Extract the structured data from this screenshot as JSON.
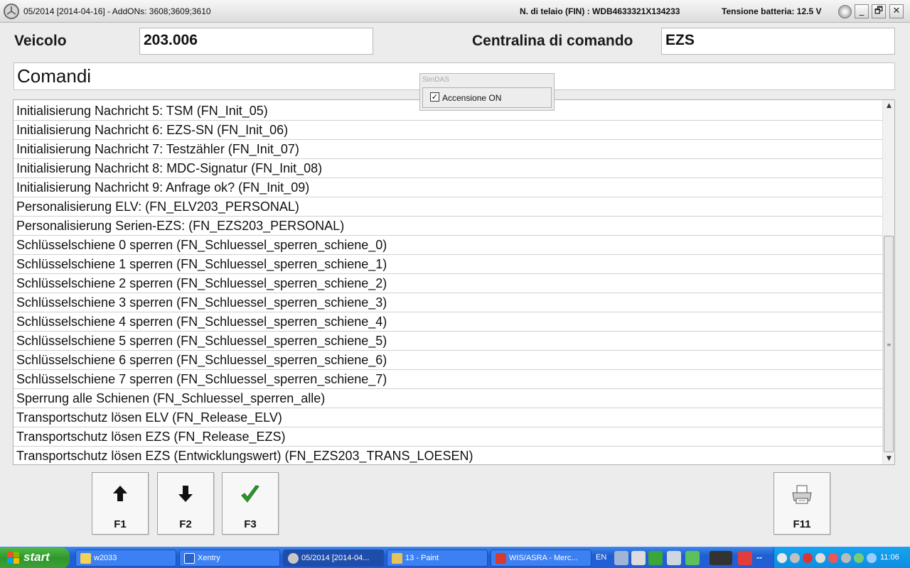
{
  "window": {
    "title": "05/2014 [2014-04-16] - AddONs: 3608;3609;3610",
    "fin": "N. di telaio (FIN) : WDB4633321X134233",
    "battery": "Tensione batteria: 12.5 V",
    "controls": {
      "minimize": "_",
      "maximize": "🗗",
      "close": "✕"
    }
  },
  "header": {
    "vehicle_label": "Veicolo",
    "vehicle_value": "203.006",
    "ecu_label": "Centralina di comando",
    "ecu_value": "EZS"
  },
  "section_title": "Comandi",
  "simdas": {
    "caption": "SimDAS",
    "checkbox_label": "Accensione ON",
    "checked": true,
    "check_mark": "✓"
  },
  "commands": [
    "Initialisierung Nachricht 5: TSM (FN_Init_05)",
    "Initialisierung Nachricht 6: EZS-SN (FN_Init_06)",
    "Initialisierung Nachricht 7: Testzähler (FN_Init_07)",
    "Initialisierung Nachricht 8: MDC-Signatur (FN_Init_08)",
    "Initialisierung Nachricht 9: Anfrage ok? (FN_Init_09)",
    "Personalisierung ELV: (FN_ELV203_PERSONAL)",
    "Personalisierung Serien-EZS: (FN_EZS203_PERSONAL)",
    "Schlüsselschiene 0 sperren (FN_Schluessel_sperren_schiene_0)",
    "Schlüsselschiene 1 sperren (FN_Schluessel_sperren_schiene_1)",
    "Schlüsselschiene 2 sperren (FN_Schluessel_sperren_schiene_2)",
    "Schlüsselschiene 3 sperren (FN_Schluessel_sperren_schiene_3)",
    "Schlüsselschiene 4 sperren (FN_Schluessel_sperren_schiene_4)",
    "Schlüsselschiene 5 sperren (FN_Schluessel_sperren_schiene_5)",
    "Schlüsselschiene 6 sperren (FN_Schluessel_sperren_schiene_6)",
    "Schlüsselschiene 7 sperren (FN_Schluessel_sperren_schiene_7)",
    "Sperrung alle Schienen (FN_Schluessel_sperren_alle)",
    "Transportschutz lösen ELV (FN_Release_ELV)",
    "Transportschutz lösen EZS (FN_Release_EZS)",
    "Transportschutz lösen EZS (Entwicklungswert) (FN_EZS203_TRANS_LOESEN)"
  ],
  "scrollbar": {
    "up_icon": "▲",
    "down_icon": "▼",
    "grip": "≡"
  },
  "function_keys": [
    {
      "label": "F1",
      "icon": "arrow-up-icon"
    },
    {
      "label": "F2",
      "icon": "arrow-down-icon"
    },
    {
      "label": "F3",
      "icon": "checkmark-icon"
    },
    {
      "label": "F11",
      "icon": "printer-icon"
    }
  ],
  "taskbar": {
    "start": "start",
    "tasks": [
      {
        "label": "w2033",
        "icon": "folder-icon",
        "color": "#f3d25a"
      },
      {
        "label": "Xentry",
        "icon": "xentry-icon",
        "color": "#2b63c9"
      },
      {
        "label": "05/2014 [2014-04...",
        "icon": "mercedes-star-icon",
        "color": "#c8c8c8"
      },
      {
        "label": "13 - Paint",
        "icon": "paint-icon",
        "color": "#e7c25a"
      },
      {
        "label": "WIS/ASRA - Merc...",
        "icon": "wis-icon",
        "color": "#d83a2e"
      }
    ],
    "language": "EN",
    "quick_ellipsis": "--",
    "clock": "11:06"
  },
  "colors": {
    "accent_green": "#2c9a2a",
    "taskbar_blue": "#245dd8",
    "tray_blue": "#0f8de0"
  }
}
